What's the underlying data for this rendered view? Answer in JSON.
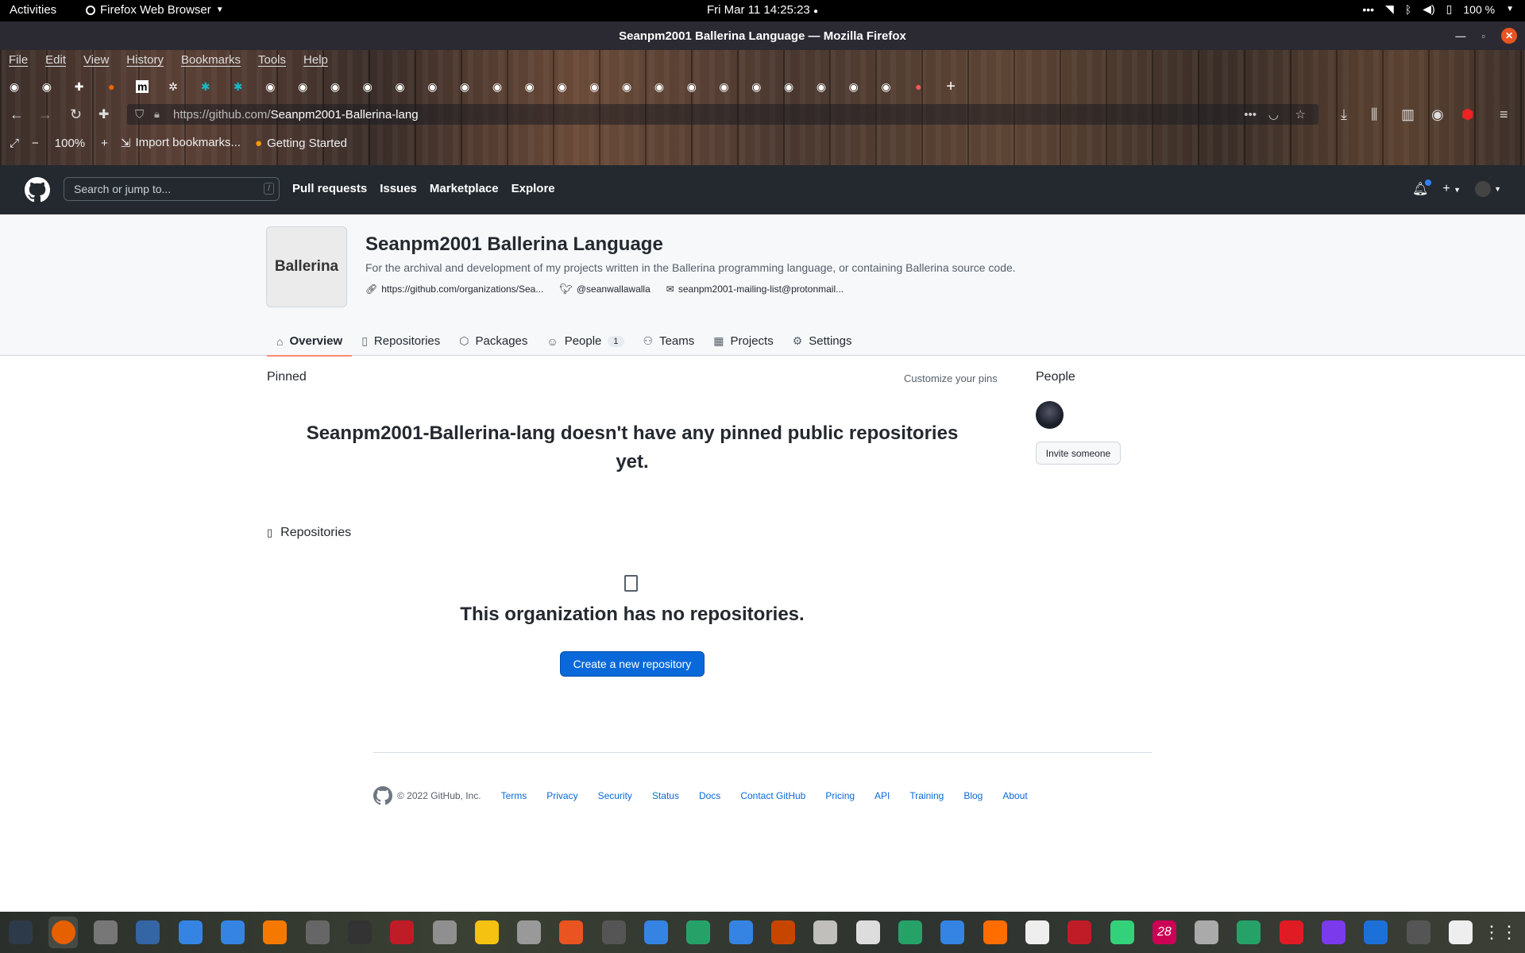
{
  "topbar": {
    "activities": "Activities",
    "app_menu": "Firefox Web Browser",
    "clock": "Fri Mar 11  14:25:23",
    "battery": "100 %"
  },
  "window": {
    "title": "Seanpm2001 Ballerina Language — Mozilla Firefox"
  },
  "menu": [
    "File",
    "Edit",
    "View",
    "History",
    "Bookmarks",
    "Tools",
    "Help"
  ],
  "tabs_icons": [
    "github-icon",
    "github-icon",
    "puzzle-icon",
    "firefox-icon",
    "medium-icon",
    "gear-icon",
    "teal-icon",
    "teal-icon",
    "github-icon",
    "github-icon",
    "github-icon",
    "github-icon",
    "github-icon",
    "github-icon",
    "github-icon",
    "github-icon",
    "github-icon",
    "github-icon",
    "github-icon",
    "github-icon",
    "github-icon",
    "github-icon",
    "github-icon",
    "github-icon",
    "github-icon",
    "github-icon",
    "github-icon",
    "github-icon",
    "orange-icon"
  ],
  "address": {
    "url_domain": "https://github.com/",
    "url_path": "Seanpm2001-Ballerina-lang"
  },
  "bookmarks": {
    "zoom": "100%",
    "import": "Import bookmarks...",
    "getting_started": "Getting Started"
  },
  "github": {
    "search_placeholder": "Search or jump to...",
    "search_key": "/",
    "nav": [
      "Pull requests",
      "Issues",
      "Marketplace",
      "Explore"
    ]
  },
  "org": {
    "logo_text": "Ballerina",
    "name": "Seanpm2001 Ballerina Language",
    "description": "For the archival and development of my projects written in the Ballerina programming language, or containing Ballerina source code.",
    "website": "https://github.com/organizations/Sea...",
    "twitter": "@seanwallawalla",
    "email": "seanpm2001-mailing-list@protonmail...",
    "tabs": [
      {
        "label": "Overview"
      },
      {
        "label": "Repositories"
      },
      {
        "label": "Packages"
      },
      {
        "label": "People",
        "count": "1"
      },
      {
        "label": "Teams"
      },
      {
        "label": "Projects"
      },
      {
        "label": "Settings"
      }
    ]
  },
  "main": {
    "pinned_heading": "Pinned",
    "customize_pins": "Customize your pins",
    "no_pinned": "Seanpm2001-Ballerina-lang doesn't have any pinned public repositories yet.",
    "repos_heading": "Repositories",
    "no_repos": "This organization has no repositories.",
    "create_repo": "Create a new repository",
    "people_heading": "People",
    "invite": "Invite someone"
  },
  "footer": {
    "copyright": "© 2022 GitHub, Inc.",
    "links": [
      "Terms",
      "Privacy",
      "Security",
      "Status",
      "Docs",
      "Contact GitHub",
      "Pricing",
      "API",
      "Training",
      "Blog",
      "About"
    ]
  },
  "dock": {
    "calendar_day": "28",
    "colors": [
      "#2d3a4a",
      "#e66000",
      "#777",
      "#3465a4",
      "#3584e4",
      "#3584e4",
      "#f57900",
      "#666",
      "#333",
      "#c01c28",
      "#8f8f8f",
      "#f5c211",
      "#999",
      "#e95420",
      "#555",
      "#3584e4",
      "#26a269",
      "#3584e4",
      "#c64600",
      "#c0bfbc",
      "#ddd",
      "#26a269",
      "#3584e4",
      "#ff6d00",
      "#eee",
      "#c01c28",
      "#33d17a",
      "#c05",
      "#aaa",
      "#26a269",
      "#e01b24",
      "#7c3aed",
      "#1c71d8",
      "#555",
      "#eee"
    ]
  }
}
